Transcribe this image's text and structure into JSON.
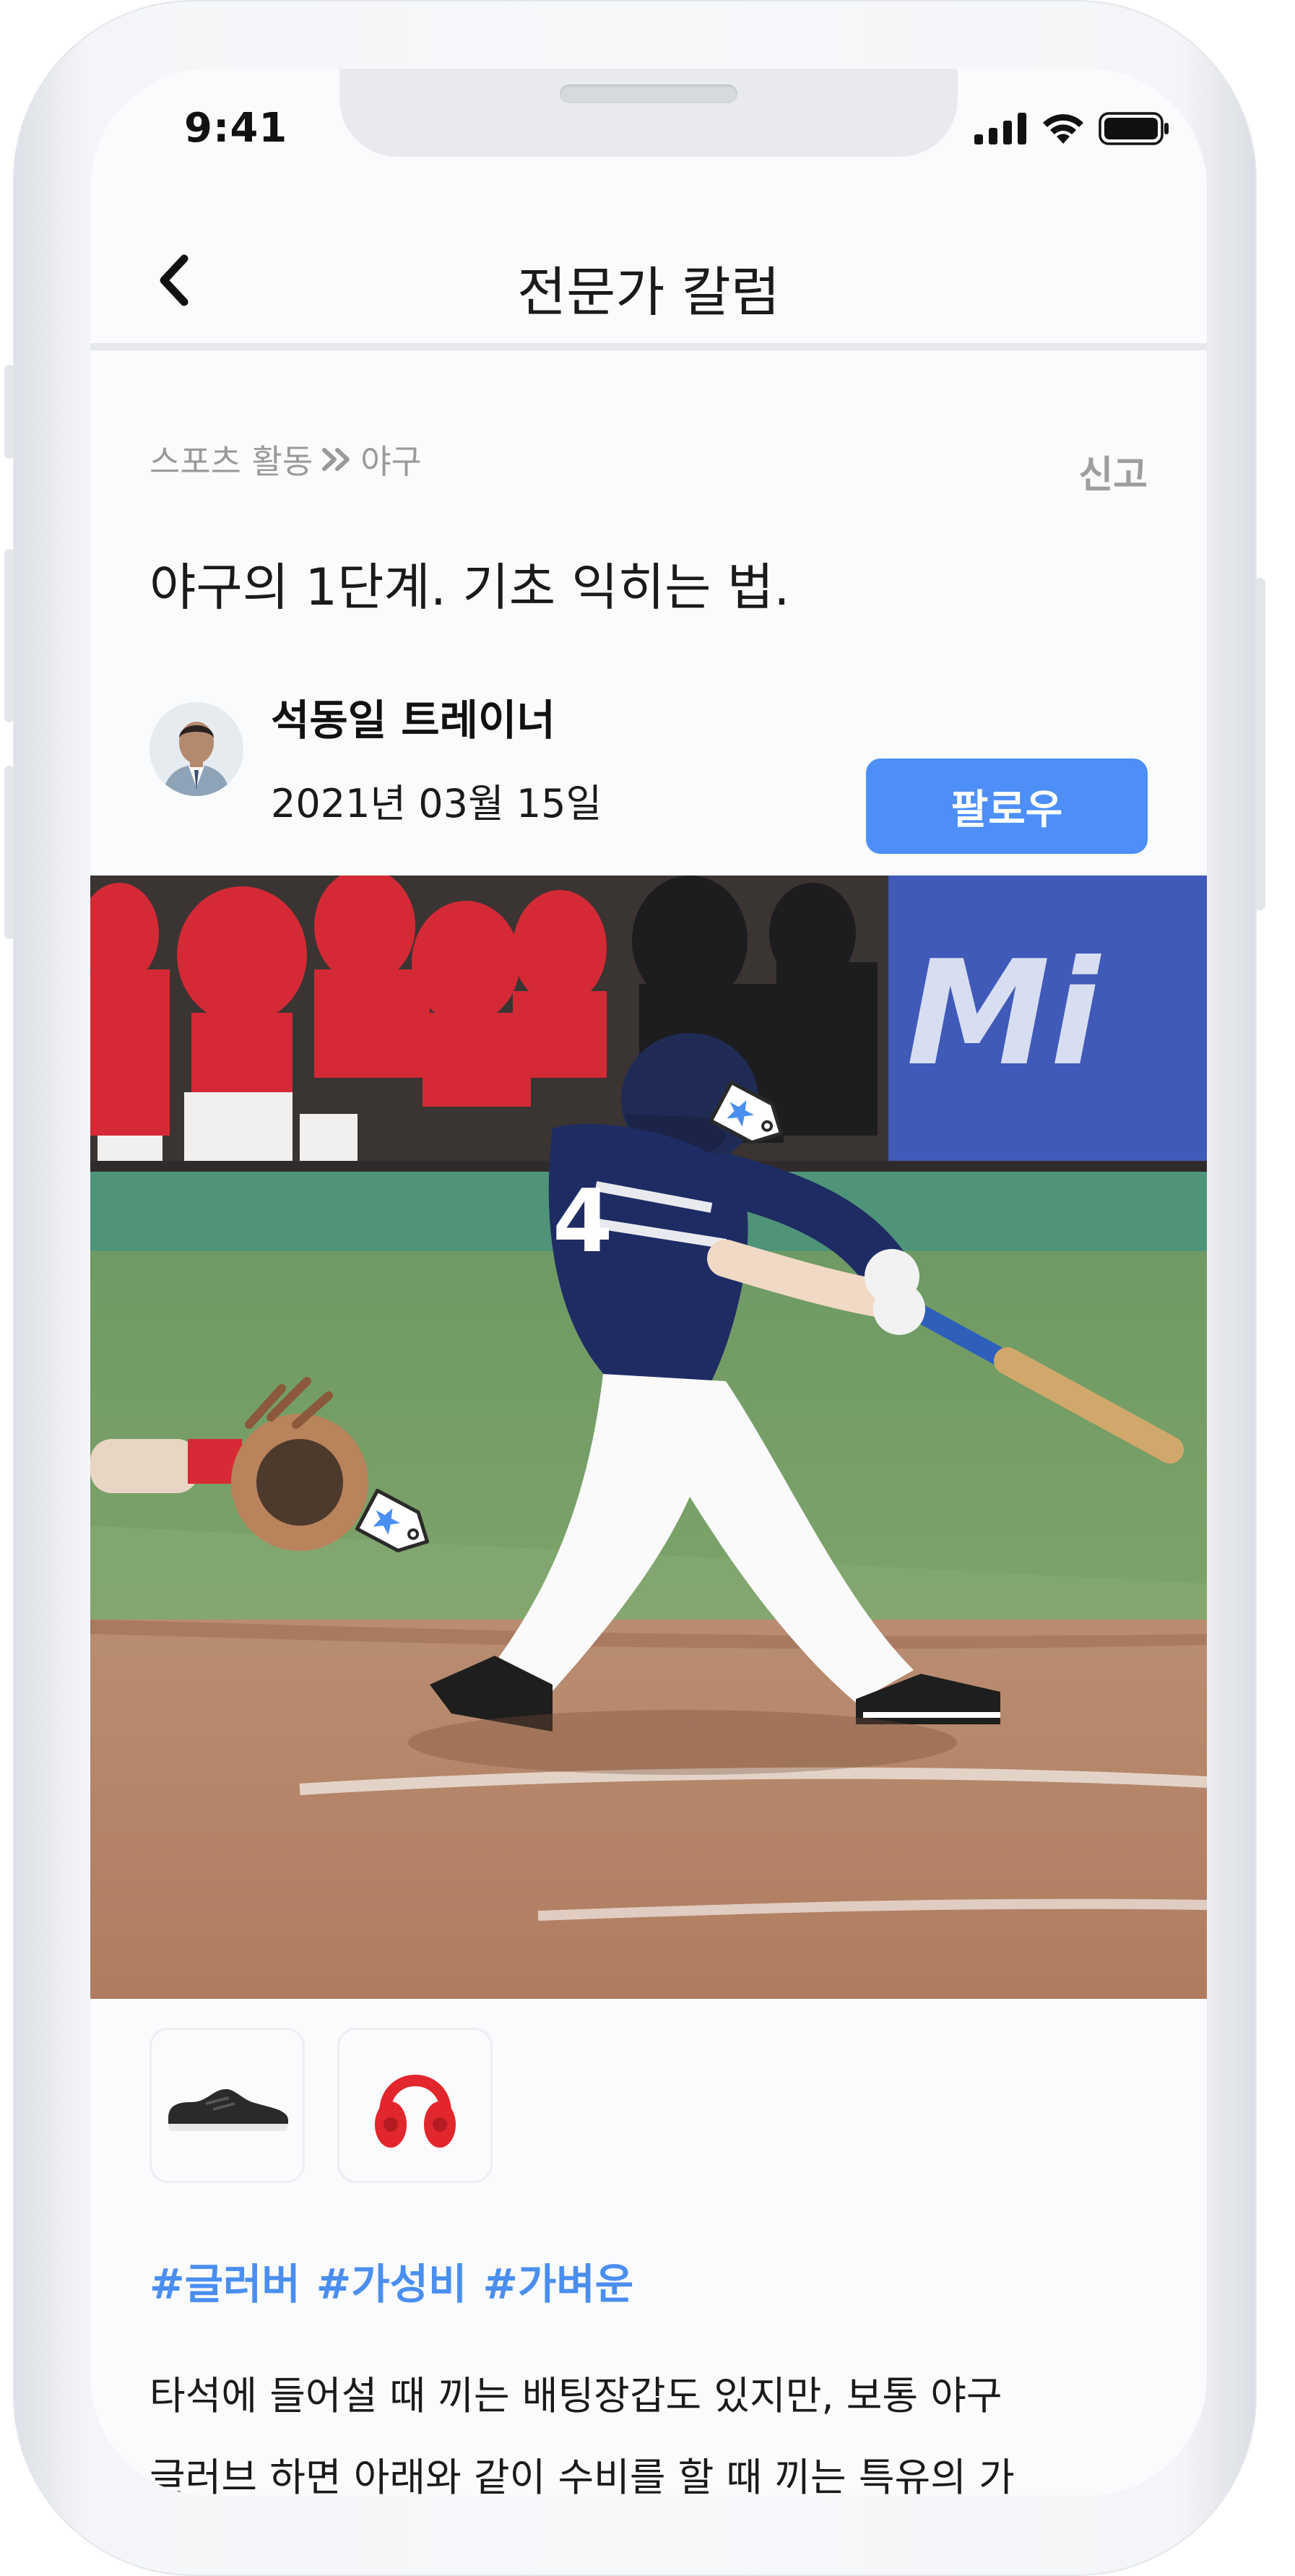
{
  "status_bar": {
    "time": "9:41",
    "icons": [
      "signal-icon",
      "wifi-icon",
      "battery-icon"
    ]
  },
  "header": {
    "back_icon": "chevron-left-icon",
    "title": "전문가 칼럼"
  },
  "breadcrumb": {
    "parent": "스포츠 활동",
    "separator_icon": "double-chevron-right-icon",
    "current": "야구"
  },
  "report_label": "신고",
  "article": {
    "title": "야구의 1단계. 기초 익히는 법.",
    "author": "석동일 트레이너",
    "date": "2021년 03월 15일",
    "follow_label": "팔로우"
  },
  "photo": {
    "tags": [
      "star-tag-icon",
      "star-tag-icon"
    ]
  },
  "products": [
    {
      "icon": "sneaker-icon"
    },
    {
      "icon": "headphones-icon"
    }
  ],
  "hashtags": [
    "#글러버",
    "#가성비",
    "#가벼운"
  ],
  "body_lines": [
    "타석에 들어설 때 끼는 배팅장갑도 있지만, 보통 야구",
    "글러브 하면 아래와 같이 수비를 할 때 끼는 특유의 가"
  ],
  "colors": {
    "accent": "#4d8ff7",
    "hashtag": "#4a8ef0",
    "muted_text": "#9a9a9a"
  }
}
